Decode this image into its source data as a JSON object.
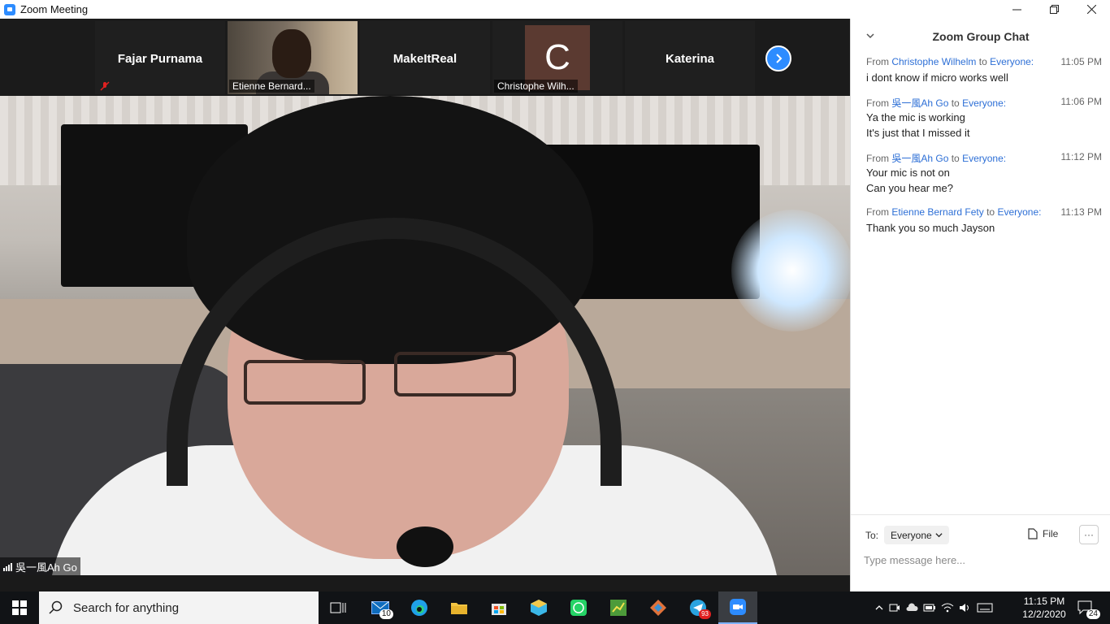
{
  "window": {
    "title": "Zoom Meeting"
  },
  "participants": [
    {
      "name": "Fajar Purnama",
      "muted": true
    },
    {
      "name": "Etienne Bernard..."
    },
    {
      "name": "MakeItReal"
    },
    {
      "name": "Christophe Wilh...",
      "avatar_letter": "C"
    },
    {
      "name": "Katerina"
    }
  ],
  "speaker": {
    "name": "吳一風Ah Go"
  },
  "chat": {
    "title": "Zoom Group Chat",
    "messages": [
      {
        "from_prefix": "From",
        "sender": "Christophe Wilhelm",
        "to_word": "to",
        "recipient": "Everyone:",
        "time": "11:05 PM",
        "lines": [
          "i dont know if micro works well"
        ]
      },
      {
        "from_prefix": "From",
        "sender": "吳一風Ah Go",
        "to_word": "to",
        "recipient": "Everyone:",
        "time": "11:06 PM",
        "lines": [
          "Ya the mic is working",
          "It's just that I missed it"
        ]
      },
      {
        "from_prefix": "From",
        "sender": "吳一風Ah Go",
        "to_word": "to",
        "recipient": "Everyone:",
        "time": "11:12 PM",
        "lines": [
          "Your mic is not on",
          "Can you hear me?"
        ]
      },
      {
        "from_prefix": "From",
        "sender": "Etienne Bernard Fety",
        "to_word": "to",
        "recipient": "Everyone:",
        "time": "11:13 PM",
        "lines": [
          "Thank you so much Jayson"
        ]
      }
    ],
    "to_label": "To:",
    "to_value": "Everyone",
    "file_label": "File",
    "more_label": "···",
    "input_placeholder": "Type message here..."
  },
  "taskbar": {
    "search_placeholder": "Search for anything",
    "mail_badge": "10",
    "telegram_badge": "93",
    "time": "11:15 PM",
    "date": "12/2/2020",
    "notification_count": "24"
  },
  "colors": {
    "accent": "#2d8cff",
    "link": "#2d6fd6"
  }
}
